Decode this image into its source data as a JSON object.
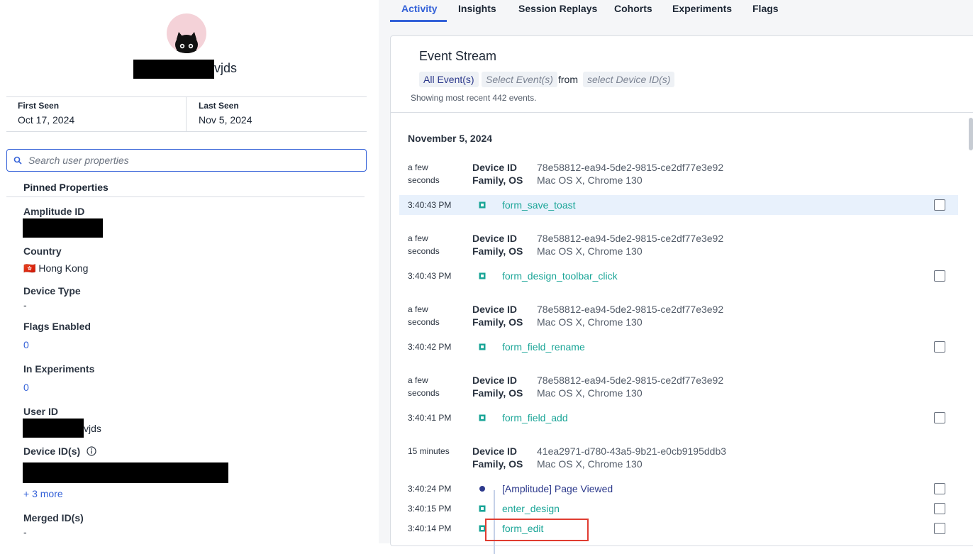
{
  "user": {
    "name_suffix": "vjds",
    "first_seen_label": "First Seen",
    "first_seen": "Oct 17, 2024",
    "last_seen_label": "Last Seen",
    "last_seen": "Nov 5, 2024"
  },
  "search": {
    "placeholder": "Search user properties"
  },
  "pinned_title": "Pinned Properties",
  "properties": {
    "amplitude_id_label": "Amplitude ID",
    "country_label": "Country",
    "country_flag": "🇭🇰",
    "country_value": "Hong Kong",
    "device_type_label": "Device Type",
    "device_type_value": "-",
    "flags_label": "Flags Enabled",
    "flags_value": "0",
    "experiments_label": "In Experiments",
    "experiments_value": "0",
    "user_id_label": "User ID",
    "user_id_suffix": "vjds",
    "device_ids_label": "Device ID(s)",
    "device_ids_more": "+ 3 more",
    "merged_label": "Merged ID(s)",
    "merged_value": "-"
  },
  "tabs": [
    "Activity",
    "Insights",
    "Session Replays",
    "Cohorts",
    "Experiments",
    "Flags"
  ],
  "stream": {
    "title": "Event Stream",
    "all_events": "All Event(s)",
    "select_events_placeholder": "Select Event(s)",
    "from_text": "from",
    "select_device_placeholder": "select Device ID(s)",
    "showing": "Showing most recent 442 events.",
    "date": "November 5, 2024",
    "device_id_label": "Device ID",
    "family_os_label": "Family, OS",
    "groups": [
      {
        "ago_line1": "a few",
        "ago_line2": "seconds",
        "device_id": "78e58812-ea94-5de2-9815-ce2df77e3e92",
        "os": "Mac OS X, Chrome 130"
      },
      {
        "ago_line1": "a few",
        "ago_line2": "seconds",
        "device_id": "78e58812-ea94-5de2-9815-ce2df77e3e92",
        "os": "Mac OS X, Chrome 130"
      },
      {
        "ago_line1": "a few",
        "ago_line2": "seconds",
        "device_id": "78e58812-ea94-5de2-9815-ce2df77e3e92",
        "os": "Mac OS X, Chrome 130"
      },
      {
        "ago_line1": "a few",
        "ago_line2": "seconds",
        "device_id": "78e58812-ea94-5de2-9815-ce2df77e3e92",
        "os": "Mac OS X, Chrome 130"
      },
      {
        "ago_line1": "15 minutes",
        "ago_line2": "",
        "device_id": "41ea2971-d780-43a5-9b21-e0cb9195ddb3",
        "os": "Mac OS X, Chrome 130"
      }
    ],
    "events": [
      {
        "time": "3:40:43 PM",
        "name": "form_save_toast"
      },
      {
        "time": "3:40:43 PM",
        "name": "form_design_toolbar_click"
      },
      {
        "time": "3:40:42 PM",
        "name": "form_field_rename"
      },
      {
        "time": "3:40:41 PM",
        "name": "form_field_add"
      },
      {
        "time": "3:40:24 PM",
        "name": "[Amplitude] Page Viewed"
      },
      {
        "time": "3:40:15 PM",
        "name": "enter_design"
      },
      {
        "time": "3:40:14 PM",
        "name": "form_edit"
      }
    ]
  },
  "colors": {
    "accent": "#3361d8",
    "event_teal": "#1aa597",
    "highlight_box": "#e03c31"
  }
}
